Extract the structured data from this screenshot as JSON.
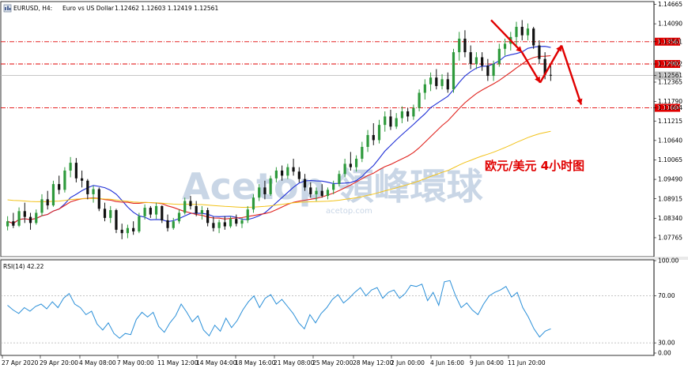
{
  "chart_data": [
    {
      "type": "candlestick",
      "header": {
        "symbol": "EURUSD, H4:",
        "description": "Euro vs US Dollar",
        "ohlc": "1.12462 1.12603 1.12419 1.12561"
      },
      "ylim": [
        1.0725,
        1.147
      ],
      "y_ticks": [
        "1.14665",
        "1.14090",
        "1.13561",
        "1.12902",
        "1.12561",
        "1.12365",
        "1.11790",
        "1.11604",
        "1.11215",
        "1.10640",
        "1.10065",
        "1.09490",
        "1.08915",
        "1.08340",
        "1.07765"
      ],
      "price_levels": [
        {
          "value": 1.13561,
          "label": "1.13561",
          "style": "dash-dot",
          "color": "#e00000"
        },
        {
          "value": 1.12902,
          "label": "1.12902",
          "style": "dash-dot",
          "color": "#e00000"
        },
        {
          "value": 1.11604,
          "label": "1.11604",
          "style": "dash-dot",
          "color": "#e00000"
        },
        {
          "value": 1.12561,
          "label": "1.12561",
          "style": "solid",
          "color": "#bfbfbf"
        }
      ],
      "candles": [
        [
          1.081,
          1.084,
          1.0798,
          1.0825
        ],
        [
          1.0825,
          1.085,
          1.0805,
          1.0812
        ],
        [
          1.0812,
          1.0866,
          1.0808,
          1.0855
        ],
        [
          1.0855,
          1.088,
          1.082,
          1.0838
        ],
        [
          1.0838,
          1.085,
          1.08,
          1.082
        ],
        [
          1.082,
          1.086,
          1.0815,
          1.085
        ],
        [
          1.085,
          1.0905,
          1.084,
          1.089
        ],
        [
          1.089,
          1.0915,
          1.086,
          1.0872
        ],
        [
          1.0872,
          1.0945,
          1.0868,
          1.0935
        ],
        [
          1.0935,
          1.096,
          1.0905,
          1.0918
        ],
        [
          1.0918,
          1.0985,
          1.091,
          1.0975
        ],
        [
          1.0975,
          1.1015,
          1.0955,
          1.0998
        ],
        [
          1.0998,
          1.1012,
          1.094,
          1.0952
        ],
        [
          1.0952,
          1.0975,
          1.0925,
          1.0945
        ],
        [
          1.0945,
          1.095,
          1.089,
          1.0905
        ],
        [
          1.0905,
          1.093,
          1.088,
          1.092
        ],
        [
          1.092,
          1.0925,
          1.0855,
          1.0862
        ],
        [
          1.0862,
          1.088,
          1.0825,
          1.0835
        ],
        [
          1.0835,
          1.087,
          1.082,
          1.0858
        ],
        [
          1.0858,
          1.0862,
          1.079,
          1.08
        ],
        [
          1.08,
          1.0818,
          1.0772,
          1.079
        ],
        [
          1.079,
          1.0815,
          1.0775,
          1.0805
        ],
        [
          1.0805,
          1.0825,
          1.0785,
          1.0795
        ],
        [
          1.0795,
          1.085,
          1.079,
          1.084
        ],
        [
          1.084,
          1.0875,
          1.083,
          1.0865
        ],
        [
          1.0865,
          1.087,
          1.0835,
          1.0845
        ],
        [
          1.0845,
          1.088,
          1.0832,
          1.087
        ],
        [
          1.087,
          1.0872,
          1.082,
          1.0828
        ],
        [
          1.0828,
          1.0845,
          1.0795,
          1.0805
        ],
        [
          1.0805,
          1.0835,
          1.08,
          1.0825
        ],
        [
          1.0825,
          1.086,
          1.0818,
          1.085
        ],
        [
          1.085,
          1.0895,
          1.0845,
          1.0885
        ],
        [
          1.0885,
          1.09,
          1.086,
          1.087
        ],
        [
          1.087,
          1.0885,
          1.084,
          1.0848
        ],
        [
          1.0848,
          1.087,
          1.083,
          1.0858
        ],
        [
          1.0858,
          1.0865,
          1.081,
          1.082
        ],
        [
          1.082,
          1.0838,
          1.0795,
          1.0805
        ],
        [
          1.0805,
          1.083,
          1.079,
          1.0822
        ],
        [
          1.0822,
          1.084,
          1.08,
          1.081
        ],
        [
          1.081,
          1.084,
          1.0805,
          1.0832
        ],
        [
          1.0832,
          1.0845,
          1.081,
          1.0818
        ],
        [
          1.0818,
          1.0835,
          1.0805,
          1.0828
        ],
        [
          1.0828,
          1.087,
          1.082,
          1.086
        ],
        [
          1.086,
          1.0905,
          1.085,
          1.0895
        ],
        [
          1.0895,
          1.0935,
          1.0885,
          1.0925
        ],
        [
          1.0925,
          1.0945,
          1.089,
          1.0905
        ],
        [
          1.0905,
          1.096,
          1.09,
          1.0952
        ],
        [
          1.0952,
          1.0985,
          1.094,
          1.0975
        ],
        [
          1.0975,
          1.099,
          1.0945,
          1.096
        ],
        [
          1.096,
          1.0995,
          1.095,
          1.0985
        ],
        [
          1.0985,
          1.101,
          1.096,
          1.0972
        ],
        [
          1.0972,
          1.0985,
          1.094,
          1.095
        ],
        [
          1.095,
          1.0965,
          1.0915,
          1.0925
        ],
        [
          1.0925,
          1.094,
          1.0895,
          1.0905
        ],
        [
          1.0905,
          1.0925,
          1.0885,
          1.0915
        ],
        [
          1.0915,
          1.0935,
          1.0895,
          1.09
        ],
        [
          1.09,
          1.0925,
          1.089,
          1.0918
        ],
        [
          1.0918,
          1.0945,
          1.0905,
          1.0935
        ],
        [
          1.0935,
          1.0975,
          1.0928,
          1.0965
        ],
        [
          1.0965,
          1.101,
          1.0955,
          1.0995
        ],
        [
          1.0995,
          1.103,
          1.0975,
          1.0985
        ],
        [
          1.0985,
          1.102,
          1.0972,
          1.101
        ],
        [
          1.101,
          1.106,
          1.1,
          1.1045
        ],
        [
          1.1045,
          1.1095,
          1.103,
          1.108
        ],
        [
          1.108,
          1.1115,
          1.105,
          1.1065
        ],
        [
          1.1065,
          1.1125,
          1.1055,
          1.111
        ],
        [
          1.111,
          1.115,
          1.109,
          1.1135
        ],
        [
          1.1135,
          1.1155,
          1.1095,
          1.1105
        ],
        [
          1.1105,
          1.1145,
          1.1098,
          1.113
        ],
        [
          1.113,
          1.1165,
          1.1115,
          1.115
        ],
        [
          1.115,
          1.116,
          1.112,
          1.1135
        ],
        [
          1.1135,
          1.117,
          1.1125,
          1.116
        ],
        [
          1.116,
          1.1215,
          1.115,
          1.1205
        ],
        [
          1.1205,
          1.1245,
          1.1185,
          1.123
        ],
        [
          1.123,
          1.1265,
          1.121,
          1.125
        ],
        [
          1.125,
          1.1275,
          1.1215,
          1.1225
        ],
        [
          1.1225,
          1.126,
          1.1215,
          1.1245
        ],
        [
          1.1245,
          1.1265,
          1.1205,
          1.1215
        ],
        [
          1.1215,
          1.1335,
          1.1205,
          1.1325
        ],
        [
          1.1325,
          1.1385,
          1.13,
          1.1365
        ],
        [
          1.1365,
          1.139,
          1.131,
          1.1325
        ],
        [
          1.1325,
          1.1345,
          1.1275,
          1.129
        ],
        [
          1.129,
          1.1325,
          1.1275,
          1.131
        ],
        [
          1.131,
          1.1325,
          1.127,
          1.1285
        ],
        [
          1.1285,
          1.1305,
          1.124,
          1.1255
        ],
        [
          1.1255,
          1.13,
          1.124,
          1.129
        ],
        [
          1.129,
          1.135,
          1.1282,
          1.1335
        ],
        [
          1.1335,
          1.1365,
          1.1315,
          1.135
        ],
        [
          1.135,
          1.1385,
          1.133,
          1.137
        ],
        [
          1.137,
          1.1415,
          1.1345,
          1.14
        ],
        [
          1.14,
          1.142,
          1.136,
          1.1375
        ],
        [
          1.1375,
          1.141,
          1.136,
          1.1395
        ],
        [
          1.1395,
          1.14,
          1.1335,
          1.1345
        ],
        [
          1.1345,
          1.136,
          1.129,
          1.1305
        ],
        [
          1.1305,
          1.1325,
          1.1245,
          1.1258
        ],
        [
          1.1258,
          1.1285,
          1.124,
          1.1256
        ]
      ],
      "moving_averages": [
        {
          "color": "#1f2fd6",
          "period": 10
        },
        {
          "color": "#e0231e",
          "period": 20
        },
        {
          "color": "#f2c219",
          "period": 100
        }
      ],
      "projection_path": [
        [
          1.142,
          1.1325
        ],
        [
          1.1325,
          1.1235
        ],
        [
          1.1235,
          1.1345
        ],
        [
          1.1345,
          1.117
        ]
      ],
      "annotation": "欧元/美元 4小时图",
      "watermark": [
        "Acetop 領峰環球",
        "acetop.com"
      ],
      "x_ticks": [
        "27 Apr 2020",
        "29 Apr 20:00",
        "4 May 08:00",
        "7 May 00:00",
        "11 May 12:00",
        "14 May 04:00",
        "18 May 16:00",
        "21 May 08:00",
        "25 May 20:00",
        "28 May 12:00",
        "2 Jun 00:00",
        "4 Jun 16:00",
        "9 Jun 04:00",
        "11 Jun 20:00"
      ]
    },
    {
      "type": "line",
      "title": "RSI(14) 42.22",
      "ylim": [
        20,
        100
      ],
      "y_ticks": [
        "100.00",
        "70.00",
        "30.00",
        "0.00"
      ],
      "levels": [
        70,
        30
      ],
      "values": [
        62,
        58,
        55,
        60,
        57,
        61,
        63,
        59,
        65,
        60,
        68,
        72,
        63,
        60,
        54,
        57,
        46,
        41,
        47,
        38,
        34,
        38,
        37,
        50,
        56,
        52,
        56,
        44,
        39,
        47,
        53,
        63,
        56,
        48,
        53,
        41,
        36,
        45,
        40,
        51,
        43,
        49,
        58,
        65,
        70,
        60,
        68,
        71,
        63,
        67,
        61,
        55,
        47,
        42,
        54,
        47,
        55,
        60,
        67,
        71,
        64,
        68,
        73,
        77,
        70,
        75,
        77,
        68,
        73,
        75,
        68,
        72,
        79,
        78,
        80,
        66,
        73,
        62,
        82,
        83,
        70,
        60,
        64,
        58,
        54,
        63,
        70,
        73,
        75,
        78,
        69,
        73,
        60,
        52,
        42,
        35,
        40,
        42
      ]
    }
  ]
}
